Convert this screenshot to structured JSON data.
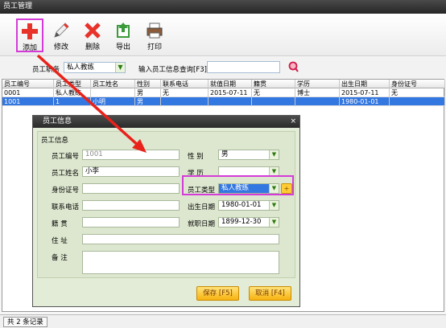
{
  "window": {
    "title": "员工管理"
  },
  "toolbar": {
    "add": "添加",
    "edit": "修改",
    "delete": "删除",
    "export": "导出",
    "print": "打印"
  },
  "filter": {
    "position_label": "员工职务",
    "position_value": "私人教练",
    "search_label": "输入员工信息查询[F3]",
    "search_value": ""
  },
  "grid": {
    "columns": [
      "员工编号",
      "员工类型",
      "员工姓名",
      "性别",
      "联系电话",
      "就值日期",
      "籍贯",
      "学历",
      "出生日期",
      "身份证号"
    ],
    "rows": [
      [
        "0001",
        "私人教练",
        "",
        "男",
        "无",
        "2015-07-11",
        "无",
        "博士",
        "2015-07-11",
        "无"
      ],
      [
        "1001",
        "1",
        "小明",
        "男",
        "",
        "",
        "",
        "",
        "1980-01-01",
        ""
      ]
    ]
  },
  "status": {
    "text": "共 2 条记录"
  },
  "dialog": {
    "title": "员工信息",
    "close": "×",
    "legend": "员工信息",
    "id_label": "员工编号",
    "id_value": "1001",
    "gender_label": "性    别",
    "gender_value": "男",
    "name_label": "员工姓名",
    "name_value": "小李",
    "edu_label": "学    历",
    "edu_value": "",
    "idcard_label": "身份证号",
    "idcard_value": "",
    "type_label": "员工类型",
    "type_value": "私人教练",
    "plus": "+",
    "phone_label": "联系电话",
    "phone_value": "",
    "birth_label": "出生日期",
    "birth_value": "1980-01-01",
    "native_label": "籍    贯",
    "native_value": "",
    "hire_label": "就职日期",
    "hire_value": "1899-12-30",
    "addr_label": "住    址",
    "addr_value": "",
    "note_label": "备    注",
    "note_value": "",
    "save": "保存 [F5]",
    "cancel": "取消 [F4]"
  },
  "colors": {
    "highlight": "#d43bd8",
    "arrow": "#e8221b",
    "selection": "#3377e0"
  }
}
